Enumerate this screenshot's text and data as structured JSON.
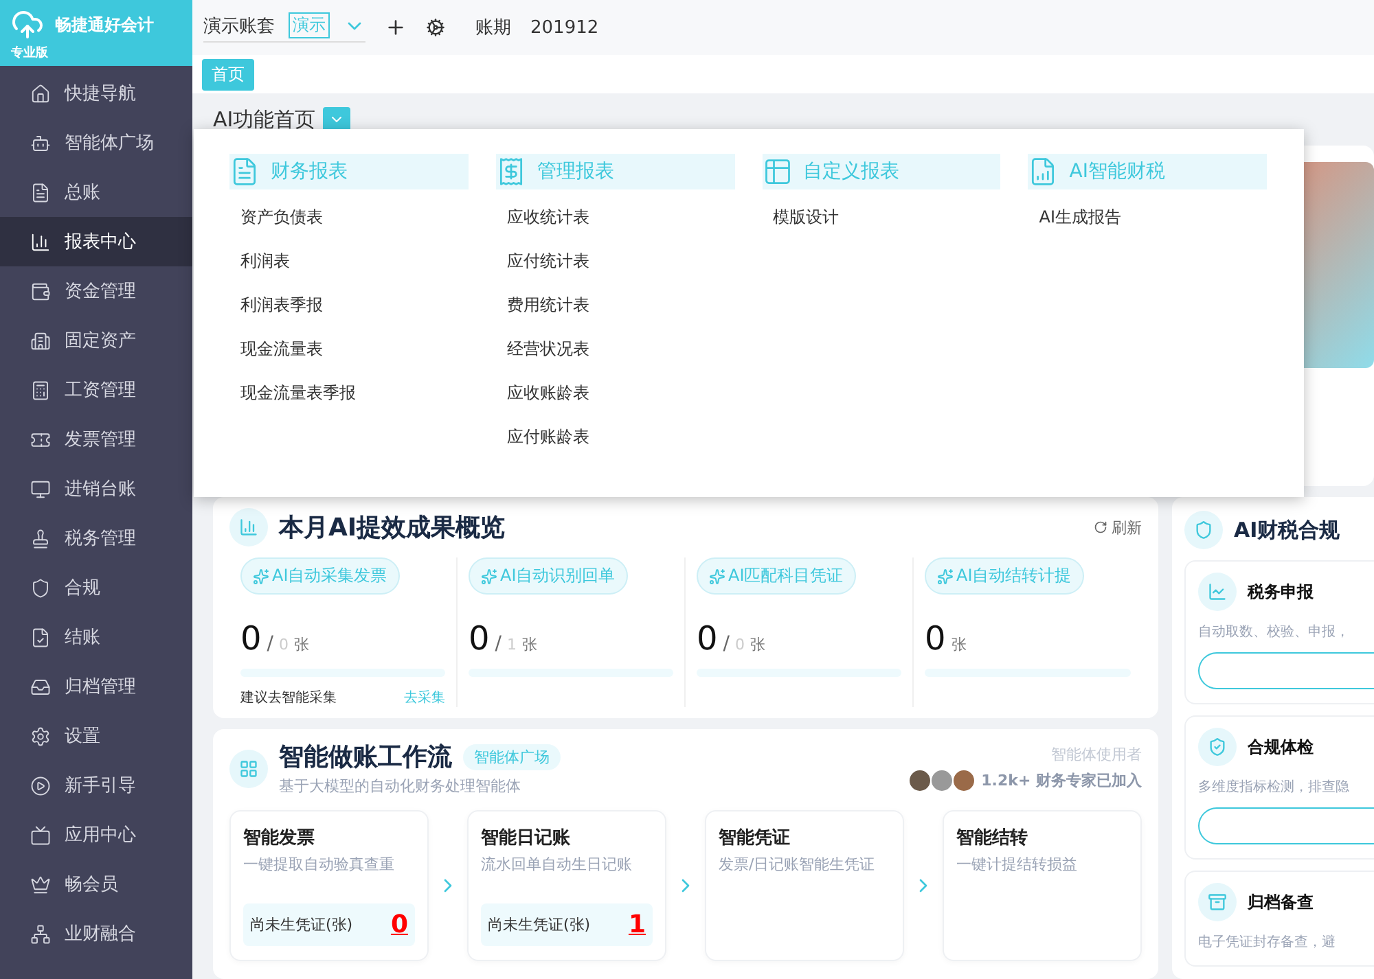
{
  "brand": {
    "name": "畅捷通好会计",
    "edition": "专业版"
  },
  "sidebar": {
    "items": [
      {
        "label": "快捷导航",
        "selected": false
      },
      {
        "label": "智能体广场",
        "selected": false
      },
      {
        "label": "总账",
        "selected": false
      },
      {
        "label": "报表中心",
        "selected": true
      },
      {
        "label": "资金管理",
        "selected": false
      },
      {
        "label": "固定资产",
        "selected": false
      },
      {
        "label": "工资管理",
        "selected": false
      },
      {
        "label": "发票管理",
        "selected": false
      },
      {
        "label": "进销台账",
        "selected": false
      },
      {
        "label": "税务管理",
        "selected": false
      },
      {
        "label": "合规",
        "selected": false
      },
      {
        "label": "结账",
        "selected": false
      },
      {
        "label": "归档管理",
        "selected": false
      },
      {
        "label": "设置",
        "selected": false
      },
      {
        "label": "新手引导",
        "selected": false
      },
      {
        "label": "应用中心",
        "selected": false
      },
      {
        "label": "畅会员",
        "selected": false
      },
      {
        "label": "业财融合",
        "selected": false
      }
    ]
  },
  "header": {
    "account": "演示账套",
    "account_tag": "演示",
    "period_label": "账期",
    "period": "201912"
  },
  "tabs": [
    {
      "label": "首页",
      "selected": true
    }
  ],
  "page_title": "AI功能首页",
  "menu": {
    "groups": [
      {
        "title": "财务报表",
        "items": [
          "资产负债表",
          "利润表",
          "利润表季报",
          "现金流量表",
          "现金流量表季报"
        ]
      },
      {
        "title": "管理报表",
        "items": [
          "应收统计表",
          "应付统计表",
          "费用统计表",
          "经营状况表",
          "应收账龄表",
          "应付账龄表"
        ]
      },
      {
        "title": "自定义报表",
        "items": [
          "模版设计"
        ]
      },
      {
        "title": "AI智能财税",
        "items": [
          "AI生成报告"
        ]
      }
    ]
  },
  "overview": {
    "title": "本月AI提效成果概览",
    "refresh": "刷新",
    "metrics": [
      {
        "chip": "AI自动采集发票",
        "count": "0",
        "slash": "/",
        "total": "0",
        "unit": "张",
        "level": 0,
        "footer": "建议去智能采集",
        "footer_link": "去采集"
      },
      {
        "chip": "AI自动识别回单",
        "count": "0",
        "slash": "/",
        "total": "1",
        "unit": "张",
        "level": 0
      },
      {
        "chip": "AI匹配科目凭证",
        "count": "0",
        "slash": "/",
        "total": "0",
        "unit": "张",
        "level": 0
      },
      {
        "chip": "AI自动结转计提",
        "count": "0",
        "unit": "张",
        "level": 0
      }
    ]
  },
  "workflow": {
    "title": "智能做账工作流",
    "tag": "智能体广场",
    "subtitle": "基于大模型的自动化财务处理智能体",
    "users_label": "智能体使用者",
    "users_count": "1.2k+ 财务专家已加入",
    "steps": [
      {
        "title": "智能发票",
        "subtitle": "一键提取自动验真查重",
        "stat_label": "尚未生凭证(张)",
        "stat_value": "0"
      },
      {
        "title": "智能日记账",
        "subtitle": "流水回单自动生日记账",
        "stat_label": "尚未生凭证(张)",
        "stat_value": "1"
      },
      {
        "title": "智能凭证",
        "subtitle": "发票/日记账智能生凭证"
      },
      {
        "title": "智能结转",
        "subtitle": "一键计提结转损益"
      }
    ]
  },
  "compliance": {
    "title": "AI财税合规",
    "items": [
      {
        "kind": "button",
        "title": "税务申报",
        "desc": "自动取数、校验、申报，"
      },
      {
        "kind": "button",
        "title": "合规体检",
        "desc": "多维度指标检测，排查隐"
      },
      {
        "kind": "plain",
        "title": "归档备查",
        "desc": "电子凭证封存备查，避"
      }
    ]
  }
}
